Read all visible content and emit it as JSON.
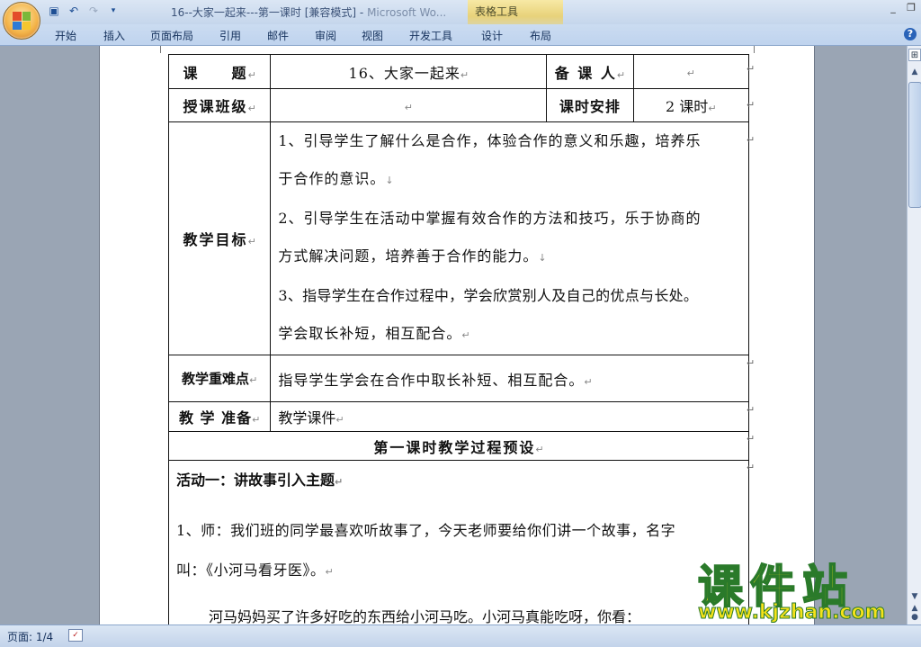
{
  "window": {
    "title": "16--大家一起来---第一课时 [兼容模式] - ",
    "app_name": "Microsoft Wo...",
    "contextual_tab_group": "表格工具",
    "controls": {
      "minimize": "_",
      "restore": "❐"
    }
  },
  "quick_access": [
    "save-icon",
    "undo-icon",
    "redo-icon",
    "customize-icon"
  ],
  "ribbon": {
    "tabs": [
      "开始",
      "插入",
      "页面布局",
      "引用",
      "邮件",
      "审阅",
      "视图",
      "开发工具",
      "设计",
      "布局"
    ],
    "help": "?"
  },
  "document": {
    "row1": {
      "label": "课　　题",
      "topic": "16、大家一起来",
      "preparer_label": "备 课 人",
      "preparer": ""
    },
    "row2": {
      "label": "授课班级",
      "class": "",
      "schedule_label": "课时安排",
      "schedule": "2 课时"
    },
    "goals": {
      "label": "教学目标",
      "lines": [
        "1、引导学生了解什么是合作，体验合作的意义和乐趣，培养乐",
        "于合作的意识。",
        "2、引导学生在活动中掌握有效合作的方法和技巧，乐于协商的",
        "方式解决问题，培养善于合作的能力。",
        "3、指导学生在合作过程中，学会欣赏别人及自己的优点与长处。",
        "学会取长补短，相互配合。"
      ]
    },
    "key_points": {
      "label": "教学重难点",
      "text": "指导学生学会在合作中取长补短、相互配合。"
    },
    "preparation": {
      "label": "教 学 准备",
      "text": "教学课件"
    },
    "process_title": "第一课时教学过程预设",
    "activity": {
      "title": "活动一：讲故事引入主题",
      "para1_line1": "1、师：我们班的同学最喜欢听故事了，今天老师要给你们讲一个故事，名字",
      "para1_line2": "叫：《小河马看牙医》。",
      "para2": "河马妈妈买了许多好吃的东西给小河马吃。小河马真能吃呀，你看："
    }
  },
  "status": {
    "page": "页面: 1/4"
  },
  "watermark": {
    "text": "课件站",
    "url": "www.kjzhan.com"
  }
}
